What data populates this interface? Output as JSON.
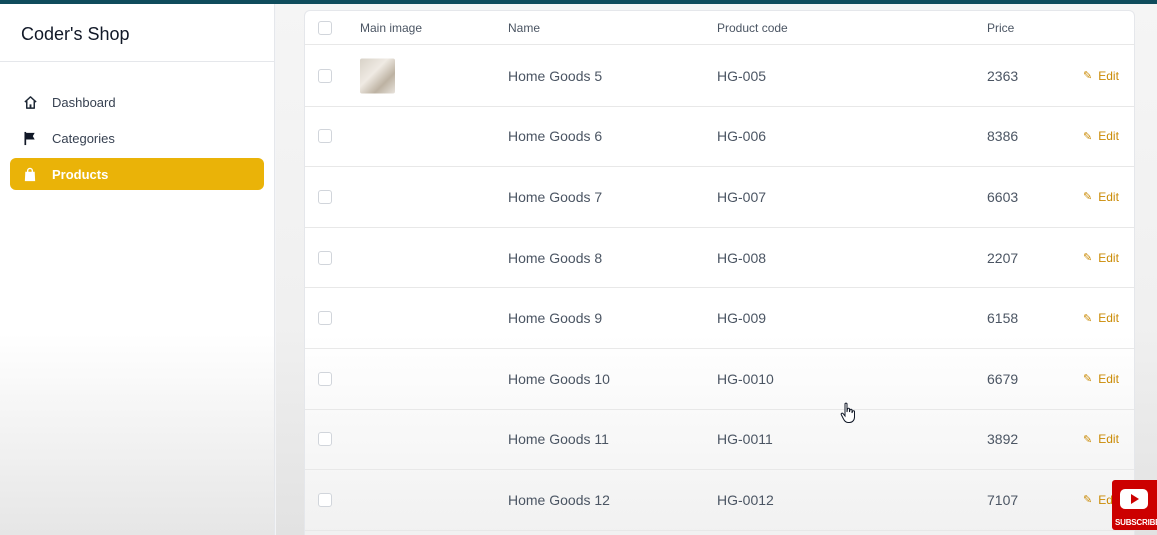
{
  "sidebar": {
    "brand": "Coder's Shop",
    "items": [
      {
        "label": "Dashboard",
        "icon": "home-icon",
        "active": false
      },
      {
        "label": "Categories",
        "icon": "flag-icon",
        "active": false
      },
      {
        "label": "Products",
        "icon": "shopping-bag-icon",
        "active": true
      }
    ]
  },
  "table": {
    "headers": {
      "image": "Main image",
      "name": "Name",
      "code": "Product code",
      "price": "Price"
    },
    "edit_label": "Edit",
    "rows": [
      {
        "name": "Home Goods 5",
        "code": "HG-005",
        "price": "2363",
        "has_image": true
      },
      {
        "name": "Home Goods 6",
        "code": "HG-006",
        "price": "8386",
        "has_image": false
      },
      {
        "name": "Home Goods 7",
        "code": "HG-007",
        "price": "6603",
        "has_image": false
      },
      {
        "name": "Home Goods 8",
        "code": "HG-008",
        "price": "2207",
        "has_image": false
      },
      {
        "name": "Home Goods 9",
        "code": "HG-009",
        "price": "6158",
        "has_image": false
      },
      {
        "name": "Home Goods 10",
        "code": "HG-0010",
        "price": "6679",
        "has_image": false
      },
      {
        "name": "Home Goods 11",
        "code": "HG-0011",
        "price": "3892",
        "has_image": false
      },
      {
        "name": "Home Goods 12",
        "code": "HG-0012",
        "price": "7107",
        "has_image": false
      }
    ]
  },
  "overlay": {
    "subscribe_label": "SUBSCRIBE"
  },
  "colors": {
    "accent": "#eab308",
    "edit": "#ca8a04",
    "topbar": "#0f4c5c"
  }
}
